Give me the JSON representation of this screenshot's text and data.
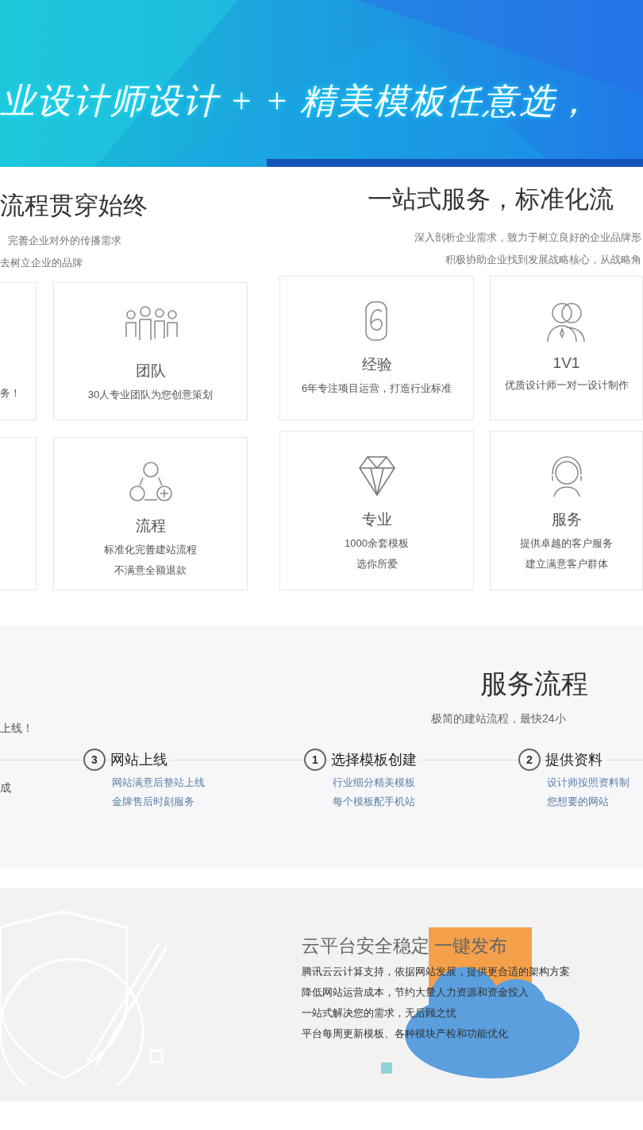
{
  "banner": {
    "title": "业设计师设计 + + 精美模板任意选，"
  },
  "intro": {
    "left": {
      "heading": "流程贯穿始终",
      "lines": [
        "完善企业对外的传播需求",
        "去树立企业的品牌"
      ]
    },
    "right": {
      "heading": "一站式服务，标准化流",
      "lines": [
        "深入剖析企业需求，致力于树立良好的企业品牌形",
        "积极协助企业找到发展战略核心，从战略角"
      ]
    }
  },
  "features": {
    "edge_text": "务！",
    "cards": [
      {
        "title": "团队",
        "lines": [
          "30人专业团队为您创意策划"
        ]
      },
      {
        "title": "经验",
        "lines": [
          "6年专注项目运营，打造行业标准"
        ]
      },
      {
        "title": "1V1",
        "lines": [
          "优质设计师一对一设计制作"
        ]
      },
      {
        "title": "流程",
        "lines": [
          "标准化完善建站流程",
          "不满意全额退款"
        ]
      },
      {
        "title": "专业",
        "lines": [
          "1000余套模板",
          "选你所爱"
        ]
      },
      {
        "title": "服务",
        "lines": [
          "提供卓越的客户服务",
          "建立满意客户群体"
        ]
      }
    ]
  },
  "process": {
    "heading": "服务流程",
    "subtitle": "极简的建站流程，最快24小",
    "edge_texts": [
      "上线！",
      "成"
    ],
    "steps": [
      {
        "number": "3",
        "title": "网站上线",
        "lines": [
          "网站满意后整站上线",
          "金牌售后时刻服务"
        ]
      },
      {
        "number": "1",
        "title": "选择模板创建",
        "lines": [
          "行业细分精美模板",
          "每个模板配手机站"
        ]
      },
      {
        "number": "2",
        "title": "提供资料",
        "lines": [
          "设计师按照资料制",
          "您想要的网站"
        ]
      }
    ]
  },
  "cloud": {
    "heading": "云平台安全稳定 一键发布",
    "lines": [
      "腾讯云云计算支持，依据网站发展，提供更合适的架构方案",
      "降低网站运营成本，节约大量人力资源和资金投入",
      "一站式解决您的需求，无后顾之忧",
      "平台每周更新模板、各种模块产检和功能优化"
    ]
  }
}
